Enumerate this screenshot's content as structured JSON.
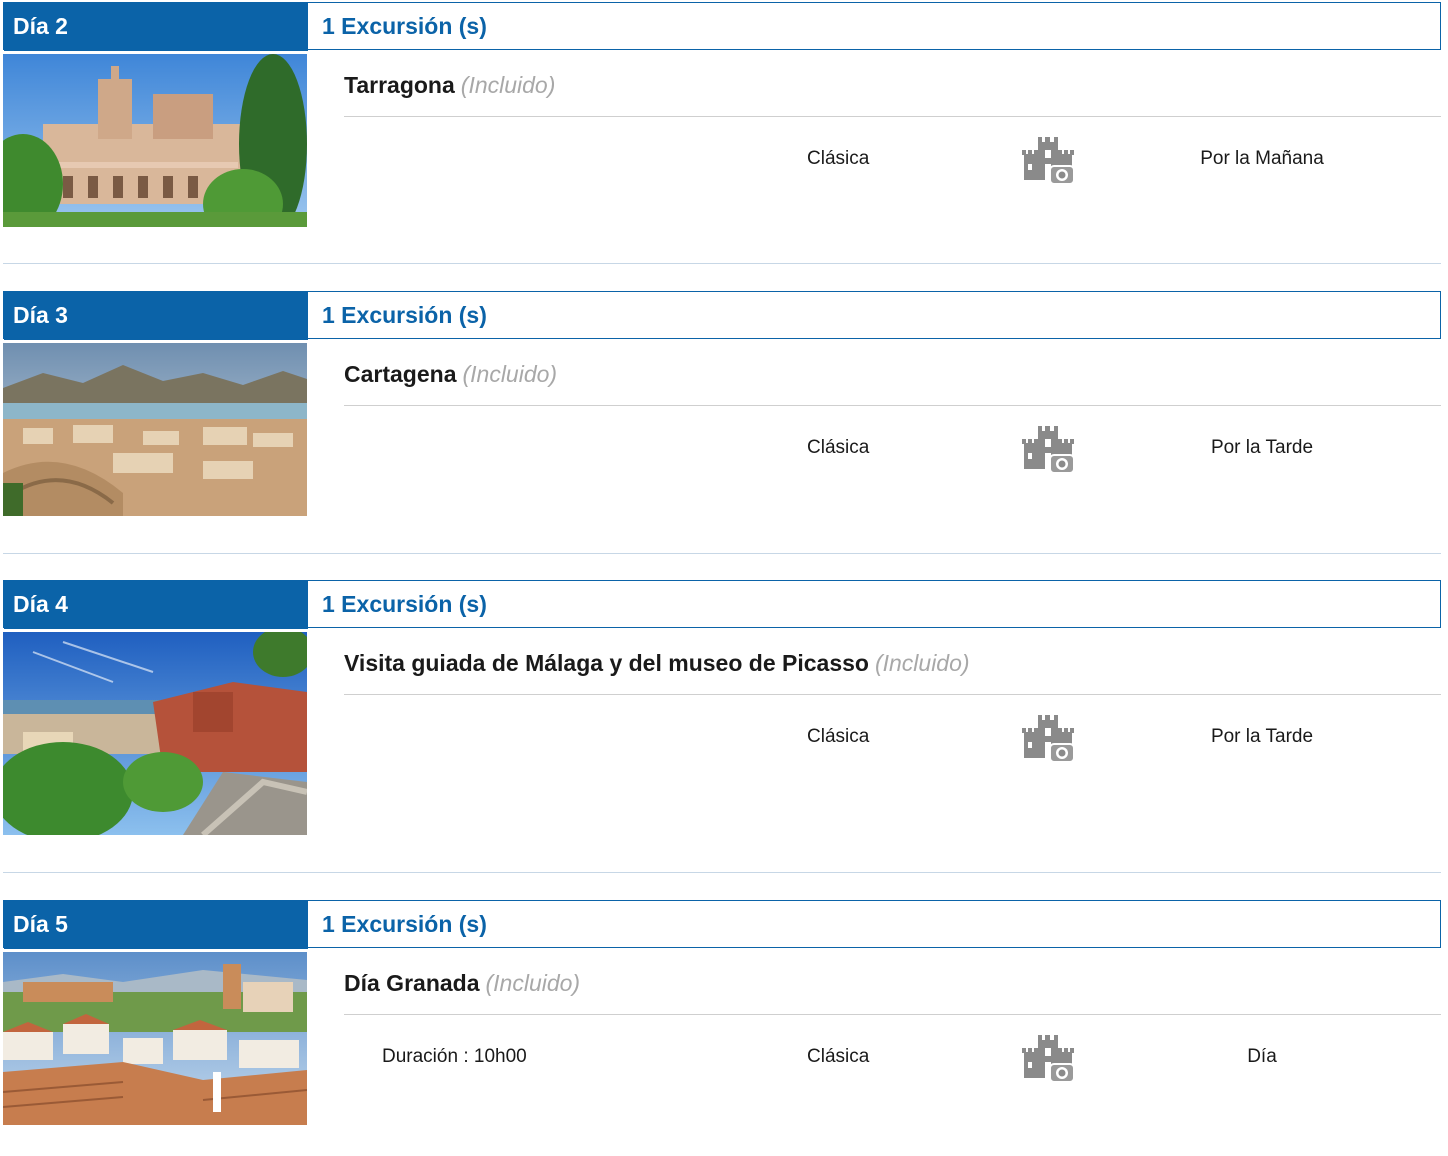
{
  "colors": {
    "accent": "#0b63a8",
    "included_text": "#a8a8a8",
    "icon_gray": "#8a8a8a"
  },
  "days": [
    {
      "day_label": "Día 2",
      "count_label": "1 Excursión (s)",
      "photo_icon": "tarragona-cathedral-photo",
      "excursion": {
        "name": "Tarragona",
        "included": "(Incluido)",
        "duration": "",
        "category": "Clásica",
        "category_icon": "castle-camera-icon",
        "time": "Por la Mañana"
      }
    },
    {
      "day_label": "Día 3",
      "count_label": "1 Excursión (s)",
      "photo_icon": "cartagena-harbor-photo",
      "excursion": {
        "name": "Cartagena",
        "included": "(Incluido)",
        "duration": "",
        "category": "Clásica",
        "category_icon": "castle-camera-icon",
        "time": "Por la Tarde"
      }
    },
    {
      "day_label": "Día 4",
      "count_label": "1 Excursión (s)",
      "photo_icon": "malaga-view-photo",
      "excursion": {
        "name": "Visita guiada de Málaga y del museo de Picasso",
        "included": "(Incluido)",
        "duration": "",
        "category": "Clásica",
        "category_icon": "castle-camera-icon",
        "time": "Por la Tarde"
      }
    },
    {
      "day_label": "Día 5",
      "count_label": "1 Excursión (s)",
      "photo_icon": "granada-rooftops-photo",
      "excursion": {
        "name": "Día Granada",
        "included": "(Incluido)",
        "duration": "Duración : 10h00",
        "category": "Clásica",
        "category_icon": "castle-camera-icon",
        "time": "Día"
      }
    }
  ]
}
